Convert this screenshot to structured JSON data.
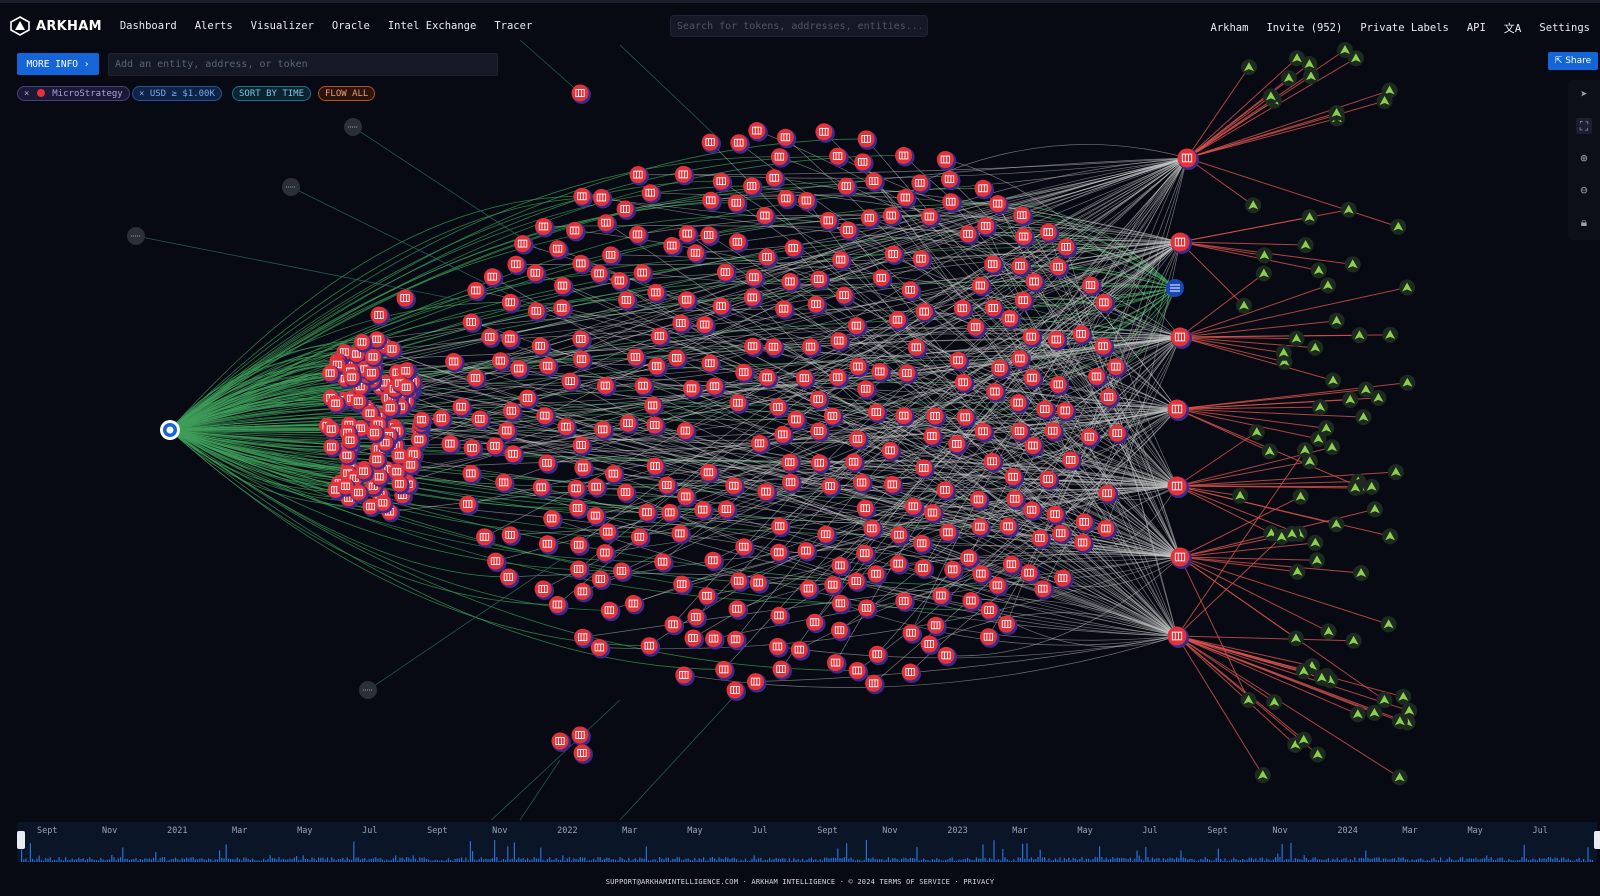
{
  "brand": {
    "name": "ARKHAM"
  },
  "nav": {
    "left": [
      "Dashboard",
      "Alerts",
      "Visualizer",
      "Oracle",
      "Intel Exchange",
      "Tracer"
    ],
    "search_placeholder": "Search for tokens, addresses, entities...",
    "right": [
      "Arkham",
      "Invite (952)",
      "Private Labels",
      "API",
      "Settings"
    ]
  },
  "controls": {
    "more_info": "MORE INFO ›",
    "entity_placeholder": "Add an entity, address, or token",
    "chip_entity": "MicroStrategy",
    "chip_usd": "USD ≥ $1.00K",
    "chip_sort": "SORT BY TIME",
    "chip_flow": "FLOW ALL",
    "share": "Share"
  },
  "graph": {
    "source_node_icon": "exchange-ring-icon",
    "hub_node_icon": "exchange-grid-icon",
    "entity_node_icon": "microstrategy-bars-icon",
    "leaf_node_icon": "green-arrow-icon",
    "inflow_color": "#3f9d5a",
    "outflow_color": "#d9534f",
    "flow_color": "#c9c9c9",
    "node_color": "#e2333b"
  },
  "timeline": {
    "labels": [
      "Sept",
      "Nov",
      "2021",
      "Mar",
      "May",
      "Jul",
      "Sept",
      "Nov",
      "2022",
      "Mar",
      "May",
      "Jul",
      "Sept",
      "Nov",
      "2023",
      "Mar",
      "May",
      "Jul",
      "Sept",
      "Nov",
      "2024",
      "Mar",
      "May",
      "Jul"
    ]
  },
  "footer": {
    "email": "SUPPORT@ARKHAMINTELLIGENCE.COM",
    "company": "ARKHAM INTELLIGENCE",
    "copyright": "© 2024",
    "terms": "TERMS OF SERVICE",
    "privacy": "PRIVACY"
  }
}
